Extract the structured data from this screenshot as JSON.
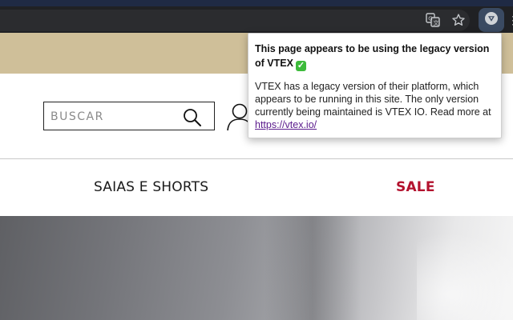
{
  "browser": {
    "translate_icon": "translate-icon",
    "bookmark_icon": "star-icon",
    "extension_icon": "extension-icon",
    "more_icon": "more-vert-icon"
  },
  "header": {
    "search": {
      "placeholder": "BUSCAR",
      "icon": "search-icon"
    },
    "account_icon": "user-icon"
  },
  "nav": {
    "items": [
      {
        "label": "SAIAS E SHORTS"
      },
      {
        "label": "SALE",
        "color": "#b3122e"
      }
    ]
  },
  "popup": {
    "title": "This page appears to be using the legacy version of VTEX",
    "title_badge": "✓",
    "body": "VTEX has a legacy version of their platform, which appears to be running in this site. The only version currently being maintained is VTEX IO. Read more at",
    "link_text": "https://vtex.io/"
  },
  "colors": {
    "promo_bar": "#cfbf99",
    "sale": "#b3122e",
    "chrome": "#202124",
    "link": "#5a1a8c"
  }
}
